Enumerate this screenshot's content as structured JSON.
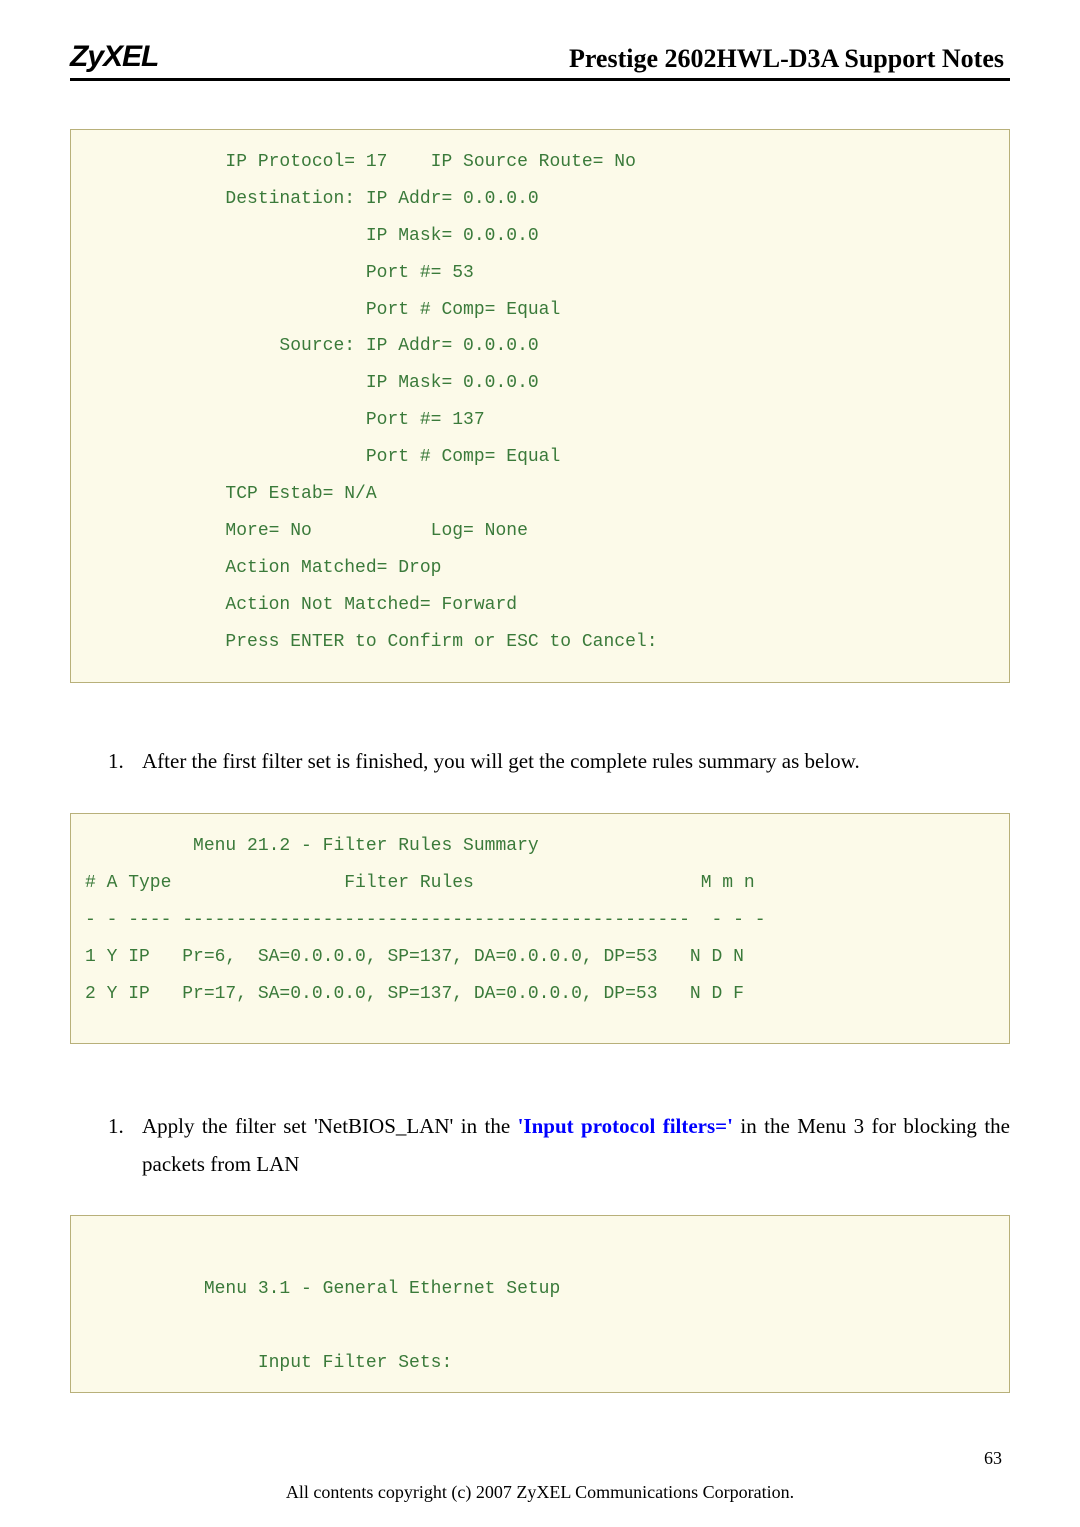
{
  "header": {
    "logo": "ZyXEL",
    "title": "Prestige 2602HWL-D3A Support Notes"
  },
  "codebox1": "             IP Protocol= 17    IP Source Route= No\n             Destination: IP Addr= 0.0.0.0\n                          IP Mask= 0.0.0.0\n                          Port #= 53\n                          Port # Comp= Equal\n                  Source: IP Addr= 0.0.0.0\n                          IP Mask= 0.0.0.0\n                          Port #= 137\n                          Port # Comp= Equal\n             TCP Estab= N/A\n             More= No           Log= None\n             Action Matched= Drop\n             Action Not Matched= Forward\n             Press ENTER to Confirm or ESC to Cancel:",
  "item1": {
    "num": "1.",
    "text": "After the first filter set is finished, you will get the complete rules summary as below."
  },
  "codebox2": "          Menu 21.2 - Filter Rules Summary\n# A Type                Filter Rules                     M m n\n- - ---- -----------------------------------------------  - - -\n1 Y IP   Pr=6,  SA=0.0.0.0, SP=137, DA=0.0.0.0, DP=53   N D N\n2 Y IP   Pr=17, SA=0.0.0.0, SP=137, DA=0.0.0.0, DP=53   N D F",
  "item2": {
    "num": "1.",
    "pre": "Apply the filter set 'NetBIOS_LAN' in the ",
    "highlight": "'Input protocol filters='",
    "post": " in the Menu 3 for blocking the packets from LAN"
  },
  "codebox3": "\n           Menu 3.1 - General Ethernet Setup\n\n                Input Filter Sets:",
  "footer": {
    "pagenum": "63",
    "copyright": "All contents copyright (c) 2007 ZyXEL Communications Corporation."
  }
}
